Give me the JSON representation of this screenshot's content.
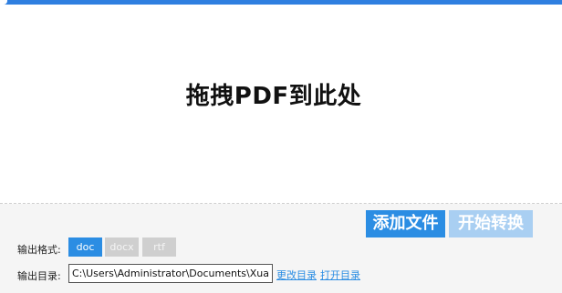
{
  "drop_zone": {
    "title": "拖拽PDF到此处"
  },
  "actions": {
    "add_files_label": "添加文件",
    "start_convert_label": "开始转换"
  },
  "output_format": {
    "label": "输出格式:",
    "options": [
      "doc",
      "docx",
      "rtf"
    ],
    "selected": "doc"
  },
  "output_dir": {
    "label": "输出目录:",
    "path": "C:\\Users\\Administrator\\Documents\\Xuan",
    "change_link": "更改目录",
    "open_link": "打开目录"
  },
  "colors": {
    "accent": "#2b8de3",
    "titlebar": "#2f7fe0",
    "disabled_button": "#a9cff2",
    "inactive_option": "#cfcfcf"
  },
  "icons": [
    "app-icon"
  ]
}
